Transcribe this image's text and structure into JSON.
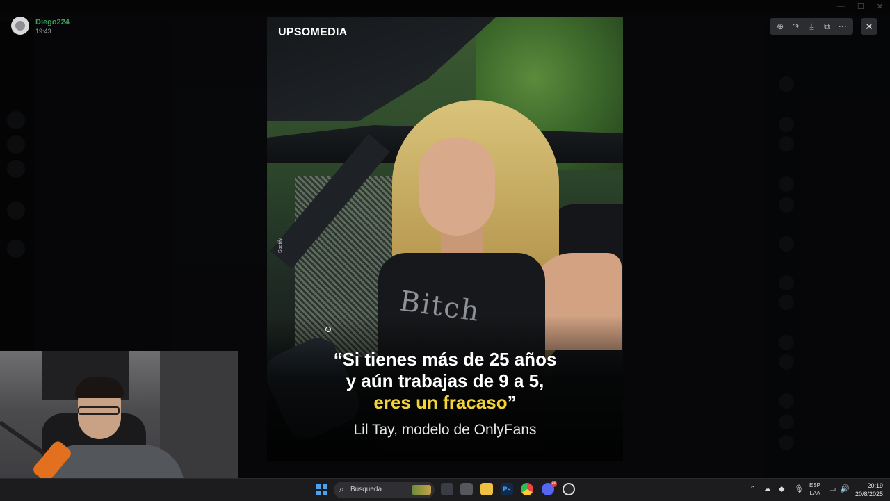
{
  "user": {
    "name": "Diego224",
    "time": "19:43"
  },
  "viewer": {
    "tools": [
      {
        "icon": "zoom-in-icon",
        "glyph": "⊕"
      },
      {
        "icon": "forward-icon",
        "glyph": "↷"
      },
      {
        "icon": "download-icon",
        "glyph": "⤓"
      },
      {
        "icon": "open-external-icon",
        "glyph": "⧉"
      },
      {
        "icon": "more-options-icon",
        "glyph": "⋯"
      }
    ],
    "close_glyph": "✕"
  },
  "media": {
    "brand": "UPSOMEDIA",
    "side_credit": "Spotify",
    "quote_line1": "“Si tienes más de 25 años",
    "quote_line2": "y aún trabajas de 9 a 5,",
    "quote_highlight": "eres un fracaso",
    "quote_close": "”",
    "attribution": "Lil Tay, modelo de OnlyFans",
    "shirt_text": "Bitch",
    "highlight_color": "#f2d33a"
  },
  "taskbar": {
    "search_placeholder": "Búsqueda",
    "apps": [
      {
        "name": "task-view",
        "label": ""
      },
      {
        "name": "app",
        "label": ""
      },
      {
        "name": "file-explorer",
        "label": ""
      },
      {
        "name": "photoshop",
        "label": "Ps"
      },
      {
        "name": "chrome",
        "label": ""
      },
      {
        "name": "discord",
        "label": "",
        "badge": "20"
      },
      {
        "name": "obs",
        "label": ""
      }
    ],
    "lang_line1": "ESP",
    "lang_line2": "LAA",
    "time": "20:19",
    "date": "20/8/2025"
  }
}
